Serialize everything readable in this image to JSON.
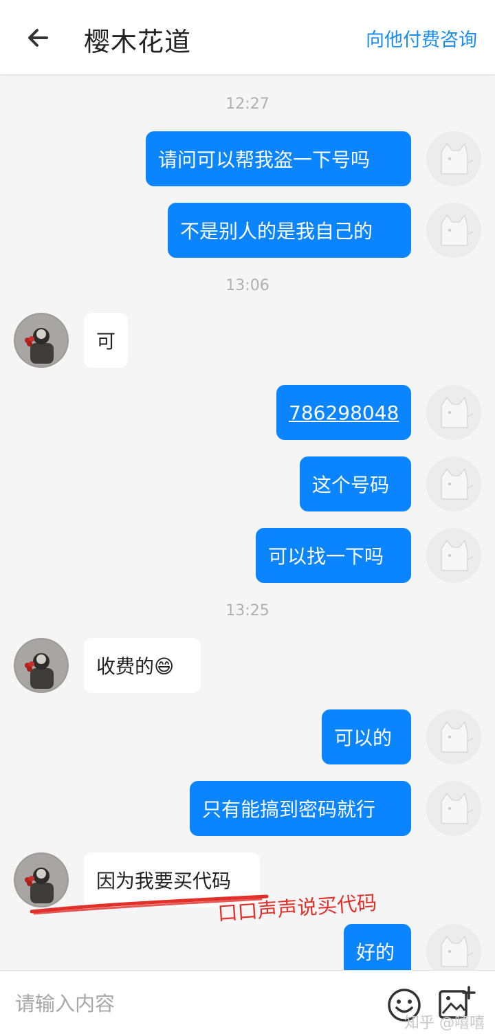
{
  "header": {
    "title": "樱木花道",
    "consult_label": "向他付费咨询"
  },
  "messages": [
    {
      "type": "timestamp",
      "text": "12:27"
    },
    {
      "type": "message",
      "direction": "out",
      "text": "请问可以帮我盗一下号吗"
    },
    {
      "type": "message",
      "direction": "out",
      "text": "不是别人的是我自己的"
    },
    {
      "type": "timestamp",
      "text": "13:06"
    },
    {
      "type": "message",
      "direction": "in",
      "text": "可"
    },
    {
      "type": "message",
      "direction": "out",
      "text": "786298048",
      "link": true
    },
    {
      "type": "message",
      "direction": "out",
      "text": "这个号码"
    },
    {
      "type": "message",
      "direction": "out",
      "text": "可以找一下吗"
    },
    {
      "type": "timestamp",
      "text": "13:25"
    },
    {
      "type": "message",
      "direction": "in",
      "text": "收费的😄"
    },
    {
      "type": "message",
      "direction": "out",
      "text": "可以的"
    },
    {
      "type": "message",
      "direction": "out",
      "text": "只有能搞到密码就行"
    },
    {
      "type": "message",
      "direction": "in",
      "text": "因为我要买代码"
    },
    {
      "type": "message",
      "direction": "out",
      "text": "好的"
    }
  ],
  "annotation": {
    "text": "口口声声说买代码",
    "color": "#e1302a"
  },
  "input": {
    "placeholder": "请输入内容",
    "value": ""
  },
  "watermark": "知乎 @嘻嘻",
  "icons": {
    "back": "arrow-left-icon",
    "emoji": "smiley-icon",
    "image": "add-image-icon"
  },
  "colors": {
    "accent": "#1a8df0",
    "outgoing_bubble": "#0a84ff",
    "incoming_bubble": "#ffffff",
    "background": "#f5f5f5"
  }
}
